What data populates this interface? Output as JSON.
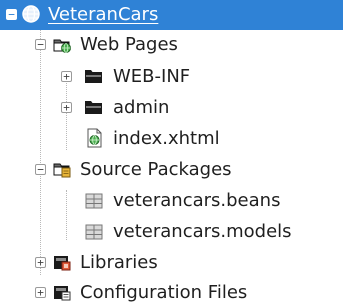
{
  "tree": {
    "nodes": [
      {
        "label": "VeteranCars",
        "icon": "globe-project-icon",
        "toggle": "−",
        "expanded": true,
        "selected": true
      },
      {
        "label": "Web Pages",
        "icon": "web-pages-folder-icon",
        "toggle": "−",
        "expanded": true
      },
      {
        "label": "WEB-INF",
        "icon": "folder-icon",
        "toggle": "+",
        "expanded": false
      },
      {
        "label": "admin",
        "icon": "folder-icon",
        "toggle": "+",
        "expanded": false
      },
      {
        "label": "index.xhtml",
        "icon": "xhtml-file-icon"
      },
      {
        "label": "Source Packages",
        "icon": "source-packages-icon",
        "toggle": "−",
        "expanded": true
      },
      {
        "label": "veterancars.beans",
        "icon": "package-icon"
      },
      {
        "label": "veterancars.models",
        "icon": "package-icon"
      },
      {
        "label": "Libraries",
        "icon": "libraries-icon",
        "toggle": "+",
        "expanded": false
      },
      {
        "label": "Configuration Files",
        "icon": "config-files-icon",
        "toggle": "+",
        "expanded": false
      }
    ]
  },
  "colors": {
    "selection": "#2f82d6",
    "folder": "#1a1a1a",
    "accent_green": "#4caf50",
    "package_gray": "#8a8a8a",
    "note_yellow": "#e8b53a"
  }
}
